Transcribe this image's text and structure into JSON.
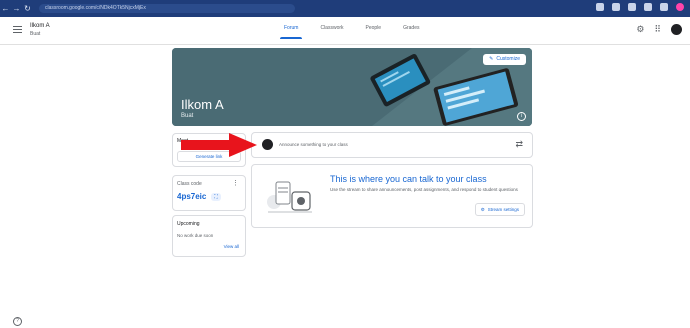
{
  "browser": {
    "back": "←",
    "forward": "→",
    "reload": "↻",
    "url": "classroom.google.com/c/NDk4OTk5NjcxMjEx"
  },
  "header": {
    "menu_icon": "hamburger-menu-icon",
    "class_name": "Ilkom A",
    "class_section": "Buat",
    "tabs": [
      {
        "label": "Forum",
        "active": true
      },
      {
        "label": "Classwork",
        "active": false
      },
      {
        "label": "People",
        "active": false
      },
      {
        "label": "Grades",
        "active": false
      }
    ],
    "apps_icon": "⠿",
    "settings_icon": "⚙"
  },
  "banner": {
    "title": "Ilkom A",
    "subtitle": "Buat",
    "customize_label": "Customize",
    "info_icon": "i",
    "color": "#4a6b74"
  },
  "meet": {
    "label": "Meet",
    "button_label": "Generate link"
  },
  "class_code": {
    "label": "Class code",
    "value": "4ps7eic",
    "more_icon": "⋮",
    "expand_icon": "⛶"
  },
  "upcoming": {
    "title": "Upcoming",
    "text": "No work due soon",
    "link": "View all"
  },
  "announce": {
    "placeholder": "Announce something to your class",
    "repost_icon": "⇄"
  },
  "talk": {
    "heading": "This is where you can talk to your class",
    "description": "Use the stream to share announcements, post assignments, and respond to student questions",
    "settings_label": "Stream settings"
  },
  "help_icon": "?",
  "colors": {
    "accent": "#1967d2",
    "browser_bar": "#1f3d7a",
    "arrow": "#e8141c"
  }
}
